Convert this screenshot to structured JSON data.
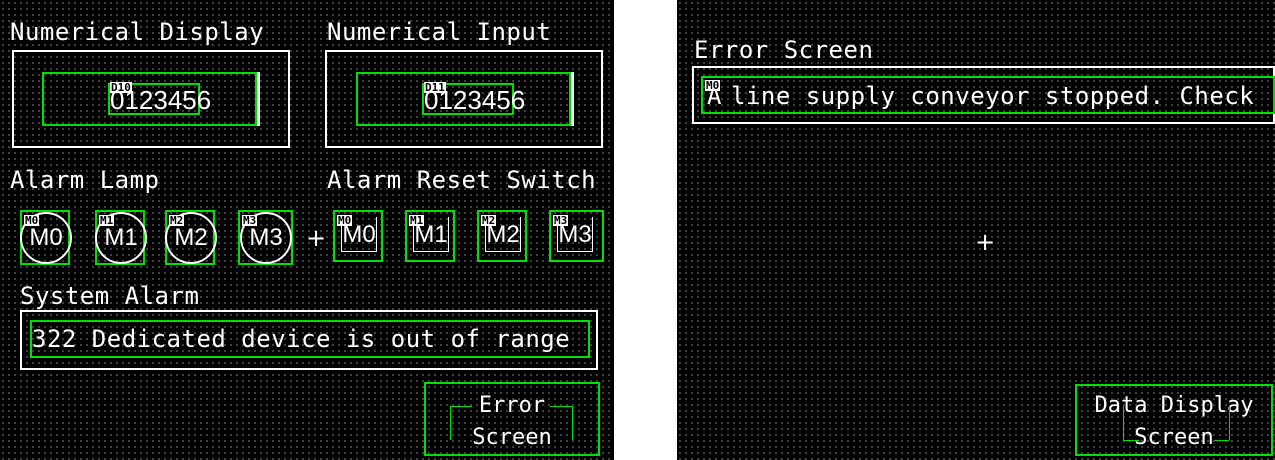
{
  "screen1": {
    "numerical_display": {
      "title": "Numerical Display",
      "device": "D10",
      "value": "0123456"
    },
    "numerical_input": {
      "title": "Numerical Input",
      "device": "D11",
      "value": "0123456"
    },
    "alarm_lamp": {
      "title": "Alarm Lamp",
      "lamps": [
        {
          "device": "M0",
          "label": "M0"
        },
        {
          "device": "M1",
          "label": "M1"
        },
        {
          "device": "M2",
          "label": "M2"
        },
        {
          "device": "M3",
          "label": "M3"
        }
      ]
    },
    "alarm_reset_switch": {
      "title": "Alarm Reset Switch",
      "switches": [
        {
          "device": "M0",
          "label": "M0"
        },
        {
          "device": "M1",
          "label": "M1"
        },
        {
          "device": "M2",
          "label": "M2"
        },
        {
          "device": "M3",
          "label": "M3"
        }
      ]
    },
    "system_alarm": {
      "title": "System Alarm",
      "message": "322 Dedicated device is out of range"
    },
    "error_screen_button": {
      "line1": "Error",
      "line2": "Screen"
    }
  },
  "screen2": {
    "title": "Error Screen",
    "alarm_device": "M0",
    "alarm_prefix": "A",
    "alarm_message": "line supply conveyor stopped. Check",
    "data_display_button": {
      "line1": "Data Display",
      "line2": "Screen"
    }
  },
  "colors": {
    "frame_green": "#00e000",
    "background": "#000000",
    "text": "#ffffff",
    "gap": "#ffffff"
  }
}
